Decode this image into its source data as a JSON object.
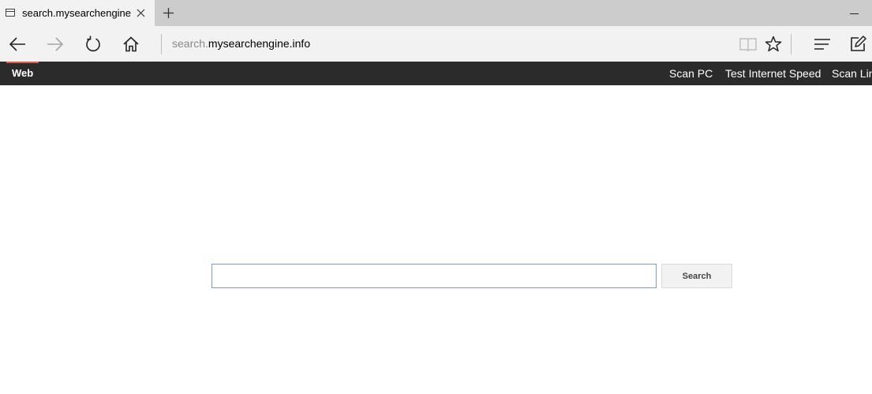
{
  "browser": {
    "tab": {
      "title": "search.mysearchengine.i",
      "favicon": "page-icon"
    },
    "address": {
      "prefix": "search.",
      "host": "mysearchengine.info"
    },
    "icons": {
      "back": "arrow-left-icon",
      "forward": "arrow-right-icon",
      "refresh": "refresh-icon",
      "home": "home-icon",
      "reading_view": "book-icon",
      "favorite": "star-icon",
      "hub": "hub-lines-icon",
      "web_note": "pen-square-icon"
    },
    "colors": {
      "tabstrip": "#cccccc",
      "toolbar": "#f2f2f2"
    }
  },
  "site_nav": {
    "active": "Web",
    "links": [
      "Scan PC",
      "Test Internet Speed",
      "Scan Lin"
    ],
    "colors": {
      "bar": "#2b2b2b",
      "accent": "#e25b45"
    }
  },
  "search": {
    "value": "",
    "placeholder": "",
    "button_label": "Search"
  }
}
